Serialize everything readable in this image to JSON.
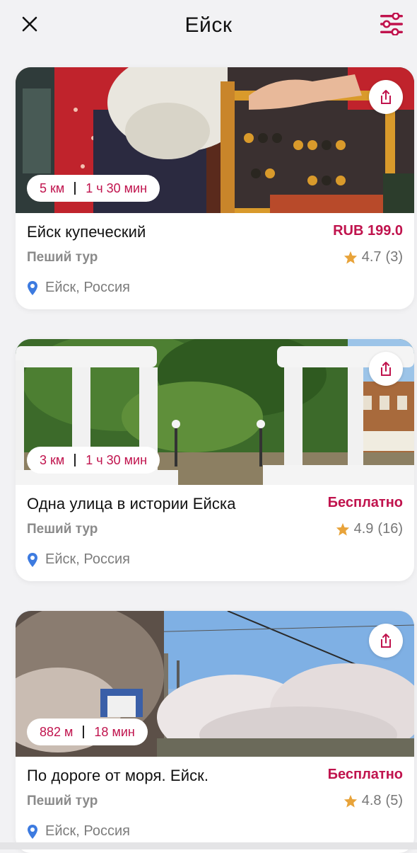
{
  "header": {
    "title": "Ейск",
    "close_icon": "close-icon",
    "filter_icon": "filter-sliders-icon"
  },
  "colors": {
    "accent": "#c0134d",
    "star": "#e8a33a",
    "pin": "#3d7be0"
  },
  "tours": [
    {
      "distance": "5 км",
      "duration": "1 ч 30 мин",
      "name": "Ейск купеческий",
      "price": "RUB 199.0",
      "type": "Пеший тур",
      "rating": "4.7",
      "reviews": "(3)",
      "location": "Ейск, Россия",
      "share_icon": "share-icon"
    },
    {
      "distance": "3 км",
      "duration": "1 ч 30 мин",
      "name": "Одна улица в истории Ейска",
      "price": "Бесплатно",
      "type": "Пеший тур",
      "rating": "4.9",
      "reviews": "(16)",
      "location": "Ейск, Россия",
      "share_icon": "share-icon"
    },
    {
      "distance": "882 м",
      "duration": "18 мин",
      "name": "По дороге от моря. Ейск.",
      "price": "Бесплатно",
      "type": "Пеший тур",
      "rating": "4.8",
      "reviews": "(5)",
      "location": "Ейск, Россия",
      "share_icon": "share-icon"
    }
  ]
}
